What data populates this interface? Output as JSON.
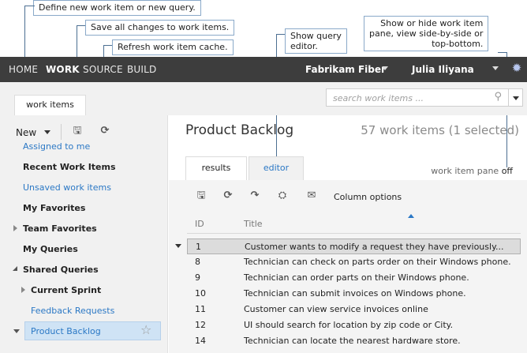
{
  "callouts": {
    "define": "Define new work item or new query.",
    "save": "Save all changes to work items.",
    "refresh": "Refresh work item cache.",
    "editor_line1": "Show query",
    "editor_line2": "editor.",
    "pane_line1": "Show or hide work item",
    "pane_line2": "pane, view side-by-side or",
    "pane_line3": "top-bottom."
  },
  "topnav": {
    "items": [
      "HOME",
      "WORK",
      "SOURCE",
      "BUILD"
    ],
    "active": "WORK",
    "project": "Fabrikam Fiber",
    "user": "Julia Iliyana",
    "gear_icon": "gear-icon"
  },
  "tabs": {
    "work_items": "work items"
  },
  "search": {
    "placeholder": "search work items ..."
  },
  "leftpane": {
    "new_label": "New",
    "queries": {
      "assigned": "Assigned to me",
      "recent": "Recent Work Items",
      "unsaved": "Unsaved work items",
      "my_favorites": "My Favorites",
      "team_favorites": "Team Favorites",
      "my_queries": "My Queries",
      "shared_queries": "Shared Queries",
      "current_sprint": "Current Sprint",
      "feedback": "Feedback Requests",
      "product_backlog": "Product Backlog"
    }
  },
  "main": {
    "title": "Product Backlog",
    "count": "57 work items (1 selected)",
    "tab_results": "results",
    "tab_editor": "editor",
    "pane_label": "work item pane",
    "pane_state": "off",
    "column_options": "Column options",
    "col_id": "ID",
    "col_title": "Title",
    "rows": [
      {
        "id": "1",
        "title": "Customer wants to modify a request they have previously..."
      },
      {
        "id": "8",
        "title": "Technician can check on parts order on their Windows phone."
      },
      {
        "id": "9",
        "title": "Technician can order parts on their Windows phone."
      },
      {
        "id": "10",
        "title": "Technician can submit invoices on Windows phone."
      },
      {
        "id": "11",
        "title": "Customer can view service invoices online"
      },
      {
        "id": "12",
        "title": "UI should search for location by zip code or City."
      },
      {
        "id": "14",
        "title": "Technician can locate the nearest hardware store."
      }
    ]
  }
}
